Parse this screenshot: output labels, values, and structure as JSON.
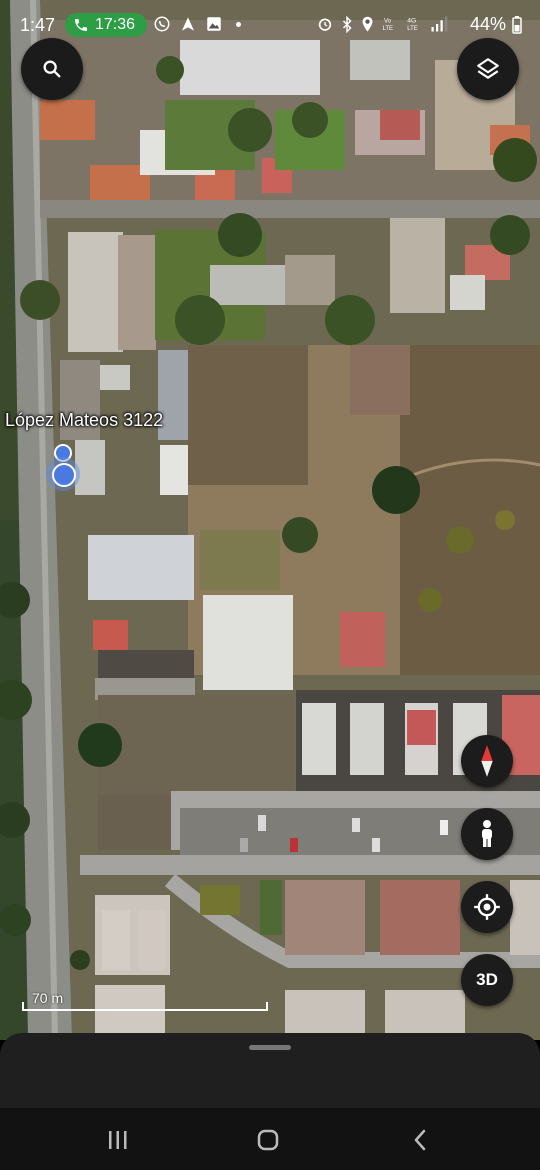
{
  "status_bar": {
    "time": "1:47",
    "call_timer": "17:36",
    "battery": "44%",
    "icons_left": [
      "phone-call-icon",
      "whatsapp-icon",
      "navigation-icon",
      "image-icon",
      "dot-icon"
    ],
    "icons_right": [
      "alarm-icon",
      "bluetooth-icon",
      "location-icon",
      "volte-icon",
      "4g-icon",
      "signal-icon",
      "battery-icon"
    ]
  },
  "map": {
    "place_label": "López Mateos 3122",
    "scale_label": "70 m",
    "view": "satellite"
  },
  "controls": {
    "search": "search-icon",
    "layers": "layers-icon",
    "compass": "compass-icon",
    "street_view": "pegman-icon",
    "my_location": "my-location-icon",
    "three_d_label": "3D"
  },
  "colors": {
    "accent_blue": "#4a7ae0",
    "call_green": "#2e9e46",
    "control_bg": "#1c1c1c",
    "compass_red": "#e53935"
  },
  "nav_bar": {
    "items": [
      "recent-apps-icon",
      "home-icon",
      "back-icon"
    ]
  }
}
